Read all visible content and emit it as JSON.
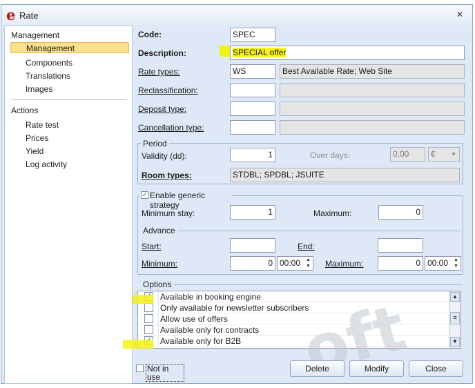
{
  "window": {
    "title": "Rate",
    "logo_letter": "e"
  },
  "sidebar": {
    "sections": [
      {
        "title": "Management",
        "items": [
          "Management",
          "Components",
          "Translations",
          "Images"
        ]
      },
      {
        "title": "Actions",
        "items": [
          "Rate test",
          "Prices",
          "Yield",
          "Log activity"
        ]
      }
    ],
    "selected": "Management"
  },
  "form": {
    "code_label": "Code:",
    "code_value": "SPEC",
    "description_label": "Description:",
    "description_value": "SPECIAL offer",
    "rate_types_label": "Rate types:",
    "rate_types_code": "WS",
    "rate_types_desc": "Best Available Rate; Web Site",
    "reclassification_label": "Reclassification:",
    "reclassification_code": "",
    "reclassification_desc": "",
    "deposit_type_label": "Deposit type:",
    "deposit_type_code": "",
    "deposit_type_desc": "",
    "cancellation_type_label": "Cancellation type:",
    "cancellation_type_code": "",
    "cancellation_type_desc": ""
  },
  "period": {
    "legend": "Period",
    "validity_label": "Validity (dd):",
    "validity_value": "1",
    "over_days_label": "Over days:",
    "over_days_value": "0,00",
    "currency": "€",
    "room_types_label": "Room types:",
    "room_types_value": "STDBL; SPDBL; JSUITE"
  },
  "strategy": {
    "enable_label": "Enable generic strategy",
    "enabled": true,
    "min_stay_label": "Minimum stay:",
    "min_stay_value": "1",
    "maximum_label": "Maximum:",
    "maximum_value": "0",
    "advance_legend": "Advance",
    "start_label": "Start:",
    "start_value": "",
    "end_label": "End:",
    "end_value": "",
    "minimum_label": "Minimum:",
    "minimum_value": "0",
    "minimum_time": "00:00",
    "max_label": "Maximum:",
    "max_value": "0",
    "max_time": "00:00"
  },
  "options": {
    "legend": "Options",
    "items": [
      {
        "label": "Available in booking engine",
        "checked": true
      },
      {
        "label": "Only available for newsletter subscribers",
        "checked": false
      },
      {
        "label": "Allow use of offers",
        "checked": false
      },
      {
        "label": "Available only for contracts",
        "checked": false
      },
      {
        "label": "Available only for B2B",
        "checked": true
      }
    ]
  },
  "footer": {
    "not_in_use_label": "Not in use",
    "not_in_use_checked": false,
    "delete_label": "Delete",
    "modify_label": "Modify",
    "close_label": "Close"
  },
  "watermark_text": "oft",
  "colors": {
    "highlight": "#f7f31a",
    "selected_nav": "#fbe18f",
    "window_bg": "#dfe8f6"
  }
}
